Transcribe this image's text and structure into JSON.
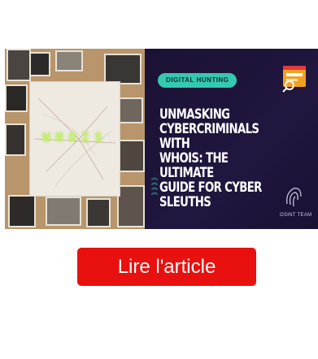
{
  "article": {
    "thumbnail": {
      "collage_text": "WHOIS",
      "badge": "DIGITAL HUNTING",
      "headline": "UNMASKING\nCYBERCRIMINALS WITH\nWHOIS: THE ULTIMATE\nGUIDE FOR CYBER\nSLEUTHS",
      "brand": "OSINT TEAM",
      "colors": {
        "panel_bg": "#1f1540",
        "badge_bg": "#34c9b1",
        "collage_glow": "#c6f06a"
      },
      "icons": [
        "search-window-icon",
        "fingerprint-logo-icon",
        "chevron-stack-icon"
      ]
    },
    "cta": {
      "label": "Lire l'article",
      "color": "#e8110f"
    }
  }
}
